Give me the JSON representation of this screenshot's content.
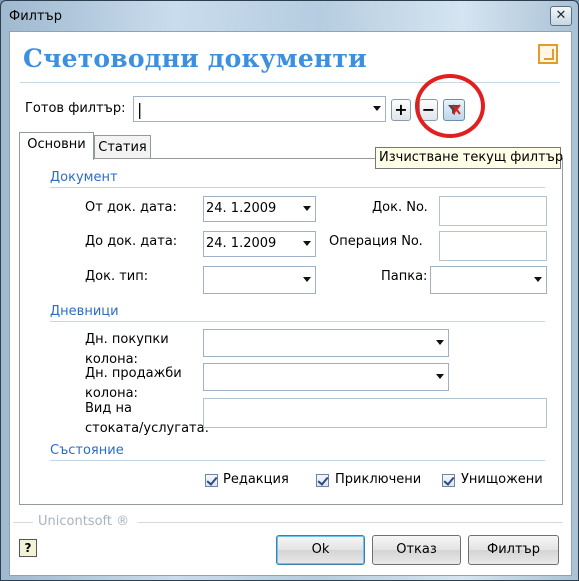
{
  "window": {
    "title": "Филтър",
    "close_symbol": "✕"
  },
  "header": {
    "title": "Счетоводни документи",
    "icon": "window-restore-icon"
  },
  "ready_filter": {
    "label": "Готов филтър:",
    "value": "",
    "add_label": "+",
    "remove_label": "−",
    "clear_icon": "clear-filter-icon",
    "clear_tooltip": "Изчистване текущ филтър"
  },
  "tabs": [
    {
      "label": "Основни",
      "active": true
    },
    {
      "label": "Статия",
      "active": false
    }
  ],
  "document_section": {
    "title": "Документ",
    "date_from_label": "От док. дата:",
    "date_from_value": "24.  1.2009",
    "date_to_label": "До док. дата:",
    "date_to_value": "24.  1.2009",
    "doc_type_label": "Док. тип:",
    "doc_type_value": "",
    "doc_no_label": "Док. No.",
    "doc_no_value": "",
    "operation_label": "Операция No.",
    "operation_value": "",
    "folder_label": "Папка:",
    "folder_value": ""
  },
  "journals_section": {
    "title": "Дневници",
    "purchases_label_1": "Дн. покупки",
    "purchases_label_2": "колона:",
    "purchases_value": "",
    "sales_label_1": "Дн. продажби",
    "sales_label_2": "колона:",
    "sales_value": "",
    "goods_label_1": "Вид на",
    "goods_label_2": "стоката/услугата:",
    "goods_value": ""
  },
  "status_section": {
    "title": "Състояние",
    "checkboxes": [
      {
        "label": "Редакция",
        "checked": true
      },
      {
        "label": "Приключени",
        "checked": true
      },
      {
        "label": "Унищожени",
        "checked": true
      }
    ]
  },
  "footer": {
    "brand": "Unicontsoft ®",
    "help_label": "?",
    "ok_label": "Ok",
    "cancel_label": "Отказ",
    "filter_label": "Филтър"
  },
  "colors": {
    "header_blue": "#3d8fe0",
    "section_blue": "#2b6dc4",
    "highlight_ring": "#e02020",
    "tooltip_bg": "#fffee6"
  }
}
